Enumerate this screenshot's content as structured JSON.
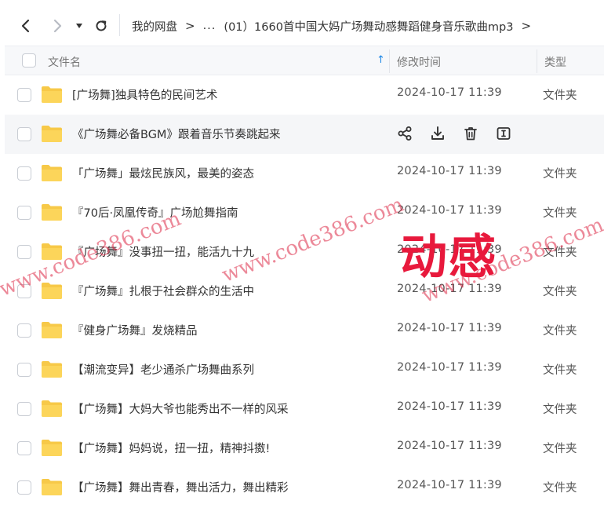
{
  "nav": {
    "breadcrumb": {
      "root": "我的网盘",
      "ellipsis": "...",
      "current": "(01）1660首中国大妈广场舞动感舞蹈健身音乐歌曲mp3"
    }
  },
  "table": {
    "columns": {
      "name": "文件名",
      "modified": "修改时间",
      "type": "类型"
    },
    "rows": [
      {
        "name": "[广场舞]独具特色的民间艺术",
        "time": "2024-10-17 11:39",
        "type": "文件夹"
      },
      {
        "name": "《广场舞必备BGM》跟着音乐节奏跳起来",
        "time": "",
        "type": ""
      },
      {
        "name": "「广场舞」最炫民族风，最美的姿态",
        "time": "2024-10-17 11:39",
        "type": "文件夹"
      },
      {
        "name": "『70后·凤凰传奇』广场尬舞指南",
        "time": "2024-10-17 11:39",
        "type": "文件夹"
      },
      {
        "name": "『广场舞』没事扭一扭，能活九十九",
        "time": "2024-10-17 11:39",
        "type": "文件夹"
      },
      {
        "name": "『广场舞』扎根于社会群众的生活中",
        "time": "2024-10-17 11:39",
        "type": "文件夹"
      },
      {
        "name": "『健身广场舞』发烧精品",
        "time": "2024-10-17 11:39",
        "type": "文件夹"
      },
      {
        "name": "【潮流变异】老少通杀广场舞曲系列",
        "time": "2024-10-17 11:39",
        "type": "文件夹"
      },
      {
        "name": "【广场舞】大妈大爷也能秀出不一样的风采",
        "time": "2024-10-17 11:39",
        "type": "文件夹"
      },
      {
        "name": "【广场舞】妈妈说，扭一扭，精神抖擞!",
        "time": "2024-10-17 11:39",
        "type": "文件夹"
      },
      {
        "name": "【广场舞】舞出青春，舞出活力，舞出精彩",
        "time": "2024-10-17 11:39",
        "type": "文件夹"
      }
    ]
  },
  "row_actions": [
    "share-icon",
    "download-icon",
    "delete-icon",
    "rename-icon"
  ],
  "overlay": {
    "word": "动感"
  },
  "watermark": "www.code386.com",
  "colors": {
    "accent": "#1e88e5",
    "folder": "#f7c948",
    "overlay": "#e8193c",
    "watermark": "#dc2846"
  }
}
